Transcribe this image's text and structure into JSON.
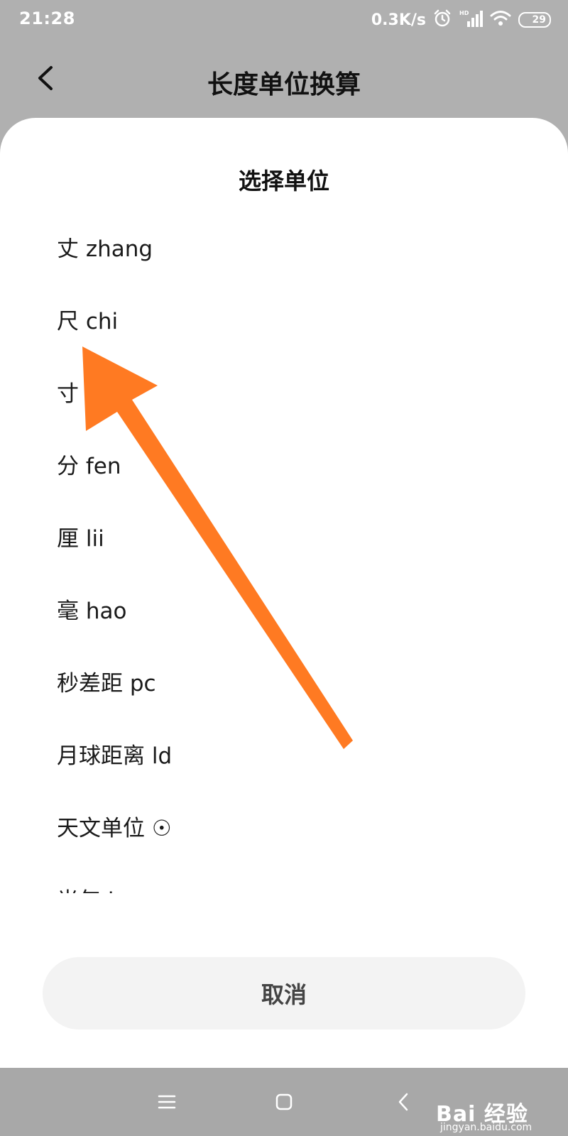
{
  "status_bar": {
    "time": "21:28",
    "net_speed": "0.3K/s",
    "battery_level": "29",
    "icons": [
      "alarm-icon",
      "hd-signal-icon",
      "wifi-icon",
      "battery-icon"
    ]
  },
  "header": {
    "title": "长度单位换算"
  },
  "sheet": {
    "title": "选择单位",
    "units": [
      "丈 zhang",
      "尺 chi",
      "寸",
      "分 fen",
      "厘 lii",
      "毫 hao",
      "秒差距 pc",
      "月球距离 ld",
      "天文单位 ☉",
      "光年 ly"
    ],
    "cancel_label": "取消"
  },
  "nav_bar": {
    "icons": [
      "menu-icon",
      "home-square-icon",
      "back-chevron-icon"
    ]
  },
  "annotation": {
    "color": "#ff7a22"
  },
  "watermark": {
    "brand": "Bai 经验",
    "url": "jingyan.baidu.com"
  },
  "colors": {
    "backdrop": "#b0b0b0",
    "sheet_bg": "#ffffff",
    "cancel_bg": "#f3f3f3"
  }
}
